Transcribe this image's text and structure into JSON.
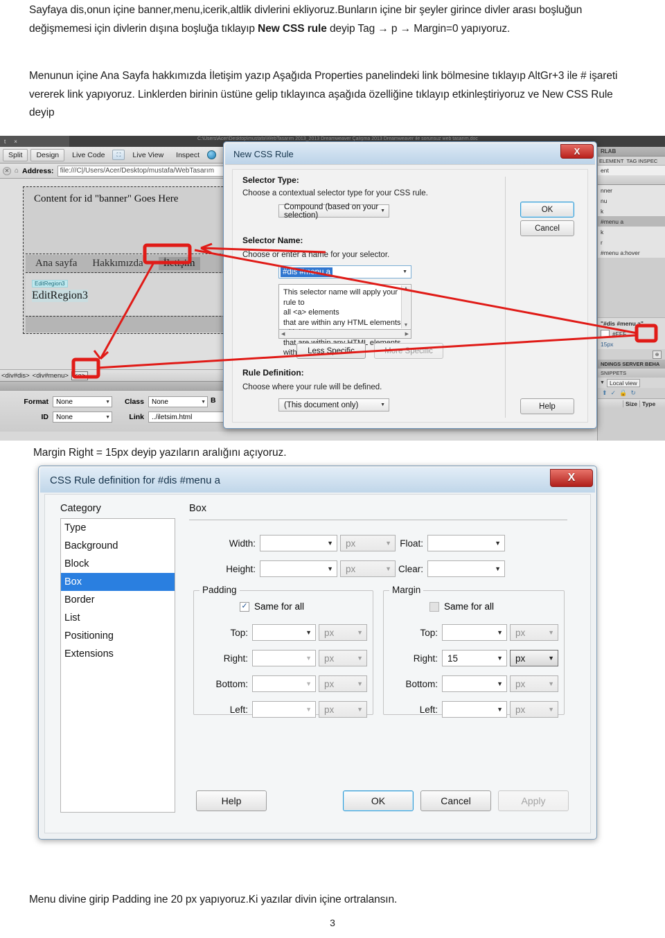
{
  "document": {
    "para1_html": "Sayfaya dis,onun içine banner,menu,icerik,altlik divlerini ekliyoruz.Bunların içine bir şeyler girince divler arası boşluğun değişmemesi için divlerin dışına boşluğa tıklayıp <b>New CSS rule</b> deyip Tag → p → Margin=0 yapıyoruz.",
    "para2": "Menunun içine Ana Sayfa hakkımızda İletişim yazıp Aşağıda Properties panelindeki link bölmesine tıklayıp  AltGr+3 ile # işareti vererek link yapıyoruz. Linklerden birinin üstüne gelip tıklayınca aşağıda <a> özelliğine tıklayıp etkinleştiriyoruz ve New CSS Rule deyip",
    "caption1": "Margin Right = 15px deyip yazıların aralığını açıyoruz.",
    "caption2": "Menu divine girip Padding ine 20 px yapıyoruz.Ki yazılar divin içine ortralansın.",
    "page_number": "3"
  },
  "shot1": {
    "window_path": "C:\\Users\\Acer\\Desktop\\mustafa\\WebTasarım 2013_2013 Dreamweaver Çalışma 2013 Dreamweaver ile sorunsuz web tasarım.doc",
    "tab_label": "t",
    "tab_close": "×",
    "toolbar": {
      "split": "Split",
      "design": "Design",
      "live_code": "Live Code",
      "live_view": "Live View",
      "inspect": "Inspect"
    },
    "address": {
      "label": "Address:",
      "value": "file:///C|/Users/Acer/Desktop/mustafa/WebTasarım"
    },
    "canvas": {
      "banner_text": "Content for id \"banner\" Goes Here",
      "menu_items": [
        "Ana sayfa",
        "Hakkımızda",
        "İletişim"
      ],
      "menu_selected": "İletişim",
      "editregion_tag": "EditRegion3",
      "editregion_text": "EditRegion3"
    },
    "tag_selector": {
      "tags": [
        "<div#dis>",
        "<div#menu>",
        "<a>"
      ],
      "active_tag": "<a>"
    },
    "properties": {
      "format_label": "Format",
      "format_value": "None",
      "id_label": "ID",
      "id_value": "None",
      "class_label": "Class",
      "class_value": "None",
      "link_label": "Link",
      "link_value": "../iletsim.html",
      "b_label": "B"
    },
    "right_panel": {
      "tab_rlab": "RLAB",
      "tab_element": "ELEMENT",
      "tab_taginspect": "TAG INSPEC",
      "current": "ent",
      "rules": [
        "nner",
        "nu",
        "k",
        "#menu a",
        "k",
        "r",
        "#menu a:hover"
      ],
      "selected_rule": "#menu a",
      "props_title": "\"#dis #menu a\"",
      "color_value": "#FFF",
      "size_value": "15px",
      "tab_bindings": "NDINGS",
      "tab_serverbeha": "SERVER BEHA",
      "tab_snippets": "SNIPPETS",
      "files_view": "Local view",
      "col_size": "Size",
      "col_type": "Type"
    },
    "new_css_rule": {
      "title": "New CSS Rule",
      "close": "X",
      "selector_type_label": "Selector Type:",
      "selector_type_desc": "Choose a contextual selector type for your CSS rule.",
      "selector_type_value": "Compound (based on your selection)",
      "selector_name_label": "Selector Name:",
      "selector_name_desc": "Choose or enter a name for your selector.",
      "selector_name_value": "#dis #menu a",
      "selector_explain_line1": "This selector name will apply your rule to",
      "selector_explain_line2": "all <a> elements",
      "selector_explain_line3": "that are within any HTML elements with id \"menu\"",
      "selector_explain_line4": "that are within any HTML elements with id \"dis\".",
      "less_specific": "Less Specific",
      "more_specific": "More Specific",
      "rule_definition_label": "Rule Definition:",
      "rule_definition_desc": "Choose where your rule will be defined.",
      "rule_definition_value": "(This document only)",
      "ok": "OK",
      "cancel": "Cancel",
      "help": "Help"
    }
  },
  "shot2": {
    "title": "CSS Rule definition for #dis #menu a",
    "close": "X",
    "category_label": "Category",
    "categories": [
      "Type",
      "Background",
      "Block",
      "Box",
      "Border",
      "List",
      "Positioning",
      "Extensions"
    ],
    "selected_category": "Box",
    "pane_title": "Box",
    "fields": {
      "width_label": "Width:",
      "width_value": "",
      "width_unit": "px",
      "height_label": "Height:",
      "height_value": "",
      "height_unit": "px",
      "float_label": "Float:",
      "float_value": "",
      "clear_label": "Clear:",
      "clear_value": ""
    },
    "padding": {
      "legend": "Padding",
      "same_for_all_label": "Same for all",
      "same_for_all_checked": true,
      "rows": [
        {
          "label": "Top:",
          "value": "",
          "unit": "px"
        },
        {
          "label": "Right:",
          "value": "",
          "unit": "px"
        },
        {
          "label": "Bottom:",
          "value": "",
          "unit": "px"
        },
        {
          "label": "Left:",
          "value": "",
          "unit": "px"
        }
      ]
    },
    "margin": {
      "legend": "Margin",
      "same_for_all_label": "Same for all",
      "same_for_all_checked": false,
      "rows": [
        {
          "label": "Top:",
          "value": "",
          "unit": "px"
        },
        {
          "label": "Right:",
          "value": "15",
          "unit": "px"
        },
        {
          "label": "Bottom:",
          "value": "",
          "unit": "px"
        },
        {
          "label": "Left:",
          "value": "",
          "unit": "px"
        }
      ]
    },
    "buttons": {
      "help": "Help",
      "ok": "OK",
      "cancel": "Cancel",
      "apply": "Apply"
    }
  },
  "annotations": {
    "color": "#E01B17",
    "highlight_boxes": [
      "menu-item-iletisim",
      "tag-a",
      "css-panel-button",
      "selector-name-field"
    ]
  }
}
